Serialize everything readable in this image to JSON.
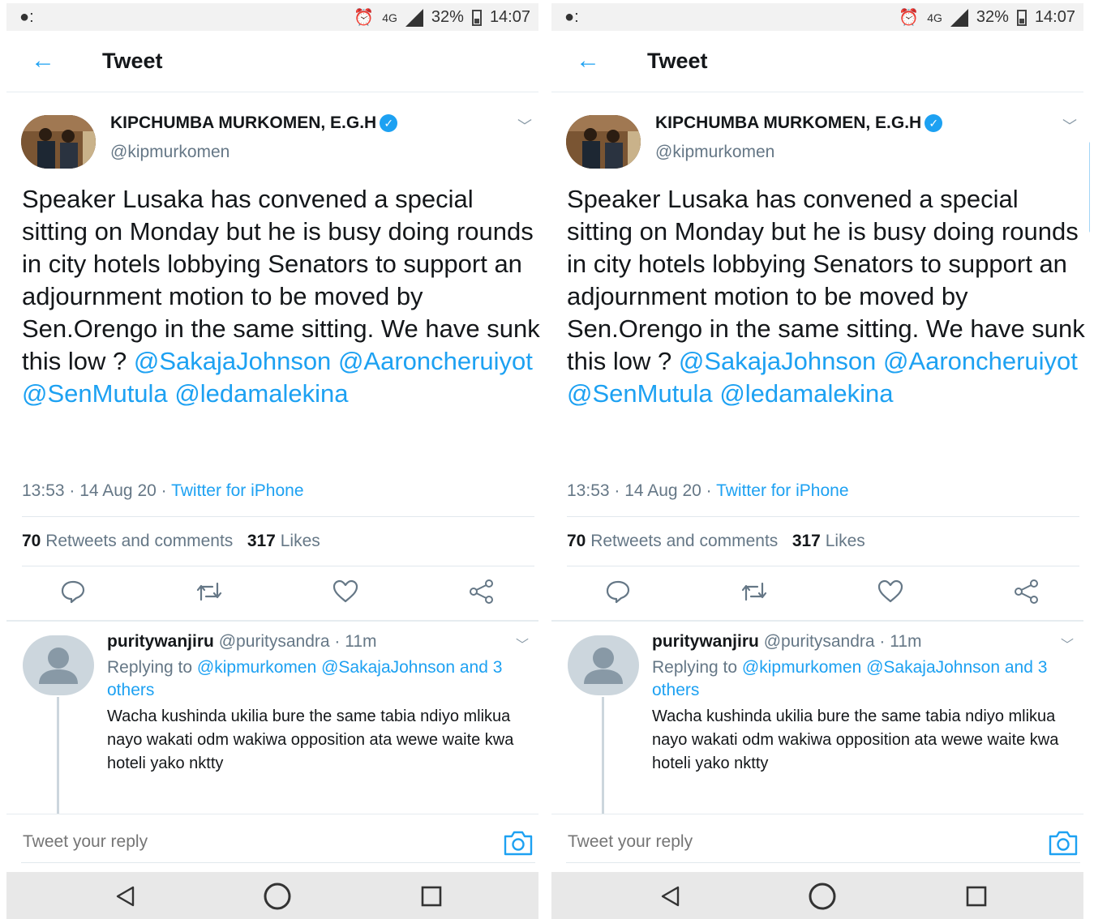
{
  "status_bar": {
    "battery": "32%",
    "time": "14:07",
    "network": "4G"
  },
  "header": {
    "title": "Tweet"
  },
  "tweet": {
    "author_name": "KIPCHUMBA MURKOMEN, E.G.H",
    "author_handle": "@kipmurkomen",
    "text_plain": "Speaker Lusaka has convened a special sitting on Monday but he is busy doing rounds in city hotels lobbying Senators to support an adjournment motion to be moved by Sen.Orengo in the same sitting. We have sunk this low ? ",
    "mentions": [
      "@SakajaJohnson",
      "@Aaroncheruiyot",
      "@SenMutula",
      "@ledamalekina"
    ],
    "time": "13:53 · 14 Aug 20 · ",
    "source": "Twitter for iPhone",
    "retweets_count": "70",
    "retweets_label": "Retweets and comments",
    "likes_count": "317",
    "likes_label": "Likes"
  },
  "reply": {
    "name": "puritywanjiru",
    "handle_time": "@puritysandra · 11m",
    "replying_prefix": "Replying to ",
    "replying_targets": "@kipmurkomen @SakajaJohnson and 3 others",
    "text": "Wacha kushinda ukilia bure the same tabia ndiyo mlikua nayo wakati odm wakiwa opposition ata wewe waite kwa hoteli yako nktty"
  },
  "compose": {
    "placeholder": "Tweet your reply"
  },
  "colors": {
    "accent": "#1da1f2",
    "text": "#14171a",
    "muted": "#657786"
  }
}
